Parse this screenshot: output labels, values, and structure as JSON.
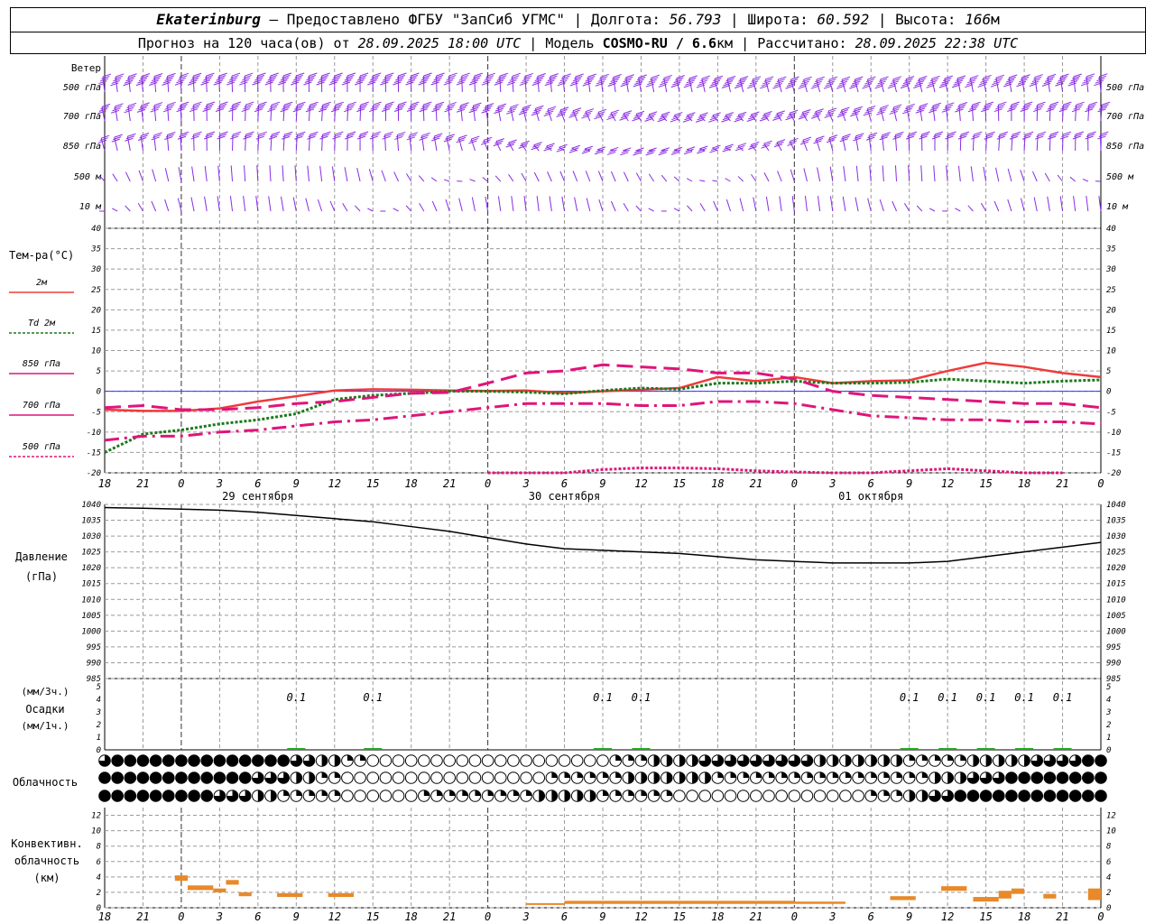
{
  "header": {
    "station": "Ekaterinburg",
    "provider": "– Предоставлено ФГБУ \"ЗапСиб УГМС\"",
    "lon_label": "Долгота:",
    "lon_value": "56.793",
    "lat_label": "Широта:",
    "lat_value": "60.592",
    "alt_label": "Высота:",
    "alt_value": "166",
    "alt_unit": "м",
    "forecast_label": "Прогноз на 120 часа(ов) от",
    "forecast_start": "28.09.2025 18:00 UTC",
    "model_label": "Модель",
    "model_name": "COSMO-RU / 6.6",
    "model_unit": "км",
    "computed_label": "Рассчитано:",
    "computed_value": "28.09.2025 22:38 UTC"
  },
  "colors": {
    "wind": "#8a2be2",
    "t2m": "#ee3b3b",
    "td2m": "#1a7a1a",
    "t850": "#e0147a",
    "t700": "#e0147a",
    "t500": "#e0147a",
    "pressure": "#000000",
    "precip": "#22aa22",
    "convective": "#e8892a",
    "zero_line": "#3030ff",
    "grid": "#999999"
  },
  "time_axis": {
    "hours": [
      "18",
      "21",
      "0",
      "3",
      "6",
      "9",
      "12",
      "15",
      "18",
      "21",
      "0",
      "3",
      "6",
      "9",
      "12",
      "15",
      "18",
      "21",
      "0",
      "3",
      "6",
      "9",
      "12",
      "15",
      "18",
      "21",
      "0"
    ],
    "days": [
      "29 сентября",
      "30 сентября",
      "01 октября"
    ]
  },
  "wind_panel": {
    "title": "Ветер",
    "levels": [
      "500 гПа",
      "700 гПа",
      "850 гПа",
      "500 м",
      "10  м"
    ]
  },
  "temp_panel": {
    "title": "Тем-ра(°C)",
    "legend": [
      {
        "label": "2м",
        "key": "t2m"
      },
      {
        "label": "Td  2м",
        "key": "td2m"
      },
      {
        "label": "850 гПа",
        "key": "t850"
      },
      {
        "label": "700 гПа",
        "key": "t700"
      },
      {
        "label": "500 гПа",
        "key": "t500"
      }
    ],
    "ticks": [
      "40",
      "35",
      "30",
      "25",
      "20",
      "15",
      "10",
      "5",
      "0",
      "-5",
      "-10",
      "-15",
      "-20"
    ]
  },
  "pressure_panel": {
    "title": "Давление",
    "unit": "(гПа)",
    "ticks": [
      "1040",
      "1035",
      "1030",
      "1025",
      "1020",
      "1015",
      "1010",
      "1005",
      "1000",
      "995",
      "990",
      "985"
    ]
  },
  "precip_panel": {
    "label1": "(мм/3ч.)",
    "label2": "Осадки",
    "label3": "(мм/1ч.)",
    "ticks": [
      "5",
      "4",
      "3",
      "2",
      "1",
      "0"
    ],
    "amounts": [
      {
        "hour": 15,
        "label": "0.1"
      },
      {
        "hour": 21,
        "label": "0.1"
      },
      {
        "hour": 39,
        "label": "0.1"
      },
      {
        "hour": 42,
        "label": "0.1"
      },
      {
        "hour": 63,
        "label": "0.1"
      },
      {
        "hour": 66,
        "label": "0.1"
      },
      {
        "hour": 69,
        "label": "0.1"
      },
      {
        "hour": 72,
        "label": "0.1"
      },
      {
        "hour": 75,
        "label": "0.1"
      }
    ]
  },
  "cloud_panel": {
    "title": "Облачность"
  },
  "convective_panel": {
    "label1": "Конвективн.",
    "label2": "облачность",
    "label3": "(км)",
    "ticks": [
      "12",
      "10",
      "8",
      "6",
      "4",
      "2",
      "0"
    ]
  },
  "chart_data": {
    "type": "line",
    "x_unit": "hours from 28.09.2025 18:00 UTC",
    "x_range": [
      0,
      78
    ],
    "temperature": {
      "ylim": [
        -20,
        40
      ],
      "series": [
        {
          "name": "2м",
          "x": [
            0,
            3,
            6,
            9,
            12,
            15,
            18,
            21,
            24,
            27,
            30,
            33,
            36,
            39,
            42,
            45,
            48,
            51,
            54,
            57,
            60,
            63,
            66,
            69,
            72,
            75,
            78
          ],
          "values": [
            -4.5,
            -4.8,
            -4.8,
            -4.2,
            -2.5,
            -1.2,
            0.2,
            0.5,
            0.4,
            0.2,
            0.1,
            0.2,
            -0.4,
            0.0,
            0.4,
            0.8,
            3.5,
            2.5,
            3.5,
            2.0,
            2.5,
            2.7,
            5.0,
            7.0,
            6.0,
            4.5,
            3.5
          ]
        },
        {
          "name": "Td 2м",
          "x": [
            0,
            3,
            6,
            9,
            12,
            15,
            18,
            21,
            24,
            27,
            30,
            33,
            36,
            39,
            42,
            45,
            48,
            51,
            54,
            57,
            60,
            63,
            66,
            69,
            72,
            75,
            78
          ],
          "values": [
            -15,
            -10.5,
            -9.5,
            -8.0,
            -7.0,
            -5.5,
            -2.0,
            -1.0,
            -0.5,
            0.0,
            0.0,
            -0.2,
            -0.6,
            0.2,
            0.8,
            0.5,
            2.0,
            2.0,
            2.5,
            2.0,
            2.0,
            2.2,
            3.0,
            2.5,
            2.0,
            2.5,
            2.8
          ]
        },
        {
          "name": "850 гПа",
          "x": [
            0,
            3,
            6,
            9,
            12,
            15,
            18,
            21,
            24,
            27,
            30,
            33,
            36,
            39,
            42,
            45,
            48,
            51,
            54,
            57,
            60,
            63,
            66,
            69,
            72,
            75,
            78
          ],
          "values": [
            -4.0,
            -3.5,
            -4.5,
            -4.5,
            -4.0,
            -3.0,
            -2.5,
            -1.5,
            -0.5,
            -0.3,
            2.0,
            4.5,
            5.0,
            6.5,
            6.0,
            5.5,
            4.5,
            4.5,
            3.0,
            0.0,
            -1.0,
            -1.5,
            -2.0,
            -2.5,
            -3.0,
            -3.0,
            -4.0
          ]
        },
        {
          "name": "700 гПа",
          "x": [
            0,
            3,
            6,
            9,
            12,
            15,
            18,
            21,
            24,
            27,
            30,
            33,
            36,
            39,
            42,
            45,
            48,
            51,
            54,
            57,
            60,
            63,
            66,
            69,
            72,
            75,
            78
          ],
          "values": [
            -12,
            -11,
            -11,
            -10,
            -9.5,
            -8.5,
            -7.5,
            -7.0,
            -6.0,
            -5.0,
            -4.0,
            -3.0,
            -3.0,
            -3.0,
            -3.5,
            -3.5,
            -2.5,
            -2.5,
            -3.0,
            -4.5,
            -6.0,
            -6.5,
            -7.0,
            -7.0,
            -7.5,
            -7.5,
            -8.0
          ]
        },
        {
          "name": "500 гПа",
          "x": [
            30,
            33,
            36,
            39,
            42,
            45,
            48,
            51,
            54,
            57,
            60,
            63,
            66,
            69,
            72,
            75
          ],
          "values": [
            -20,
            -20,
            -20,
            -19.2,
            -18.8,
            -18.8,
            -19.0,
            -19.5,
            -19.8,
            -20,
            -20,
            -19.5,
            -19.0,
            -19.5,
            -20,
            -20
          ]
        }
      ]
    },
    "pressure": {
      "ylim": [
        985,
        1040
      ],
      "x": [
        0,
        3,
        6,
        9,
        12,
        15,
        18,
        21,
        24,
        27,
        30,
        33,
        36,
        39,
        42,
        45,
        48,
        51,
        54,
        57,
        60,
        63,
        66,
        69,
        72,
        75,
        78
      ],
      "values": [
        1039,
        1038.8,
        1038.5,
        1038.2,
        1037.5,
        1036.5,
        1035.5,
        1034.5,
        1033,
        1031.5,
        1029.5,
        1027.5,
        1026,
        1025.5,
        1025,
        1024.5,
        1023.5,
        1022.5,
        1022,
        1021.5,
        1021.5,
        1021.5,
        1022,
        1023.5,
        1025,
        1026.5,
        1028
      ]
    },
    "convective_clouds_km": {
      "ylim": [
        0,
        13
      ],
      "segments": [
        {
          "x0": 5.5,
          "x1": 6.5,
          "lo": 3.5,
          "hi": 4.2
        },
        {
          "x0": 6.5,
          "x1": 8.5,
          "lo": 2.3,
          "hi": 2.9
        },
        {
          "x0": 8.5,
          "x1": 9.5,
          "lo": 2.0,
          "hi": 2.5
        },
        {
          "x0": 9.5,
          "x1": 10.5,
          "lo": 3.0,
          "hi": 3.6
        },
        {
          "x0": 10.5,
          "x1": 11.5,
          "lo": 1.5,
          "hi": 2.0
        },
        {
          "x0": 13.5,
          "x1": 15.5,
          "lo": 1.4,
          "hi": 1.9
        },
        {
          "x0": 17.5,
          "x1": 19.5,
          "lo": 1.4,
          "hi": 1.9
        },
        {
          "x0": 33,
          "x1": 36,
          "lo": 0.4,
          "hi": 0.6
        },
        {
          "x0": 36,
          "x1": 54,
          "lo": 0.5,
          "hi": 0.9
        },
        {
          "x0": 54,
          "x1": 58,
          "lo": 0.5,
          "hi": 0.8
        },
        {
          "x0": 61.5,
          "x1": 63.5,
          "lo": 1.0,
          "hi": 1.5
        },
        {
          "x0": 65.5,
          "x1": 67.5,
          "lo": 2.2,
          "hi": 2.8
        },
        {
          "x0": 68,
          "x1": 70,
          "lo": 0.8,
          "hi": 1.4
        },
        {
          "x0": 70,
          "x1": 71,
          "lo": 1.2,
          "hi": 2.2
        },
        {
          "x0": 71,
          "x1": 72,
          "lo": 1.8,
          "hi": 2.5
        },
        {
          "x0": 73.5,
          "x1": 74.5,
          "lo": 1.2,
          "hi": 1.8
        },
        {
          "x0": 77,
          "x1": 78,
          "lo": 1.0,
          "hi": 2.5
        }
      ]
    }
  }
}
